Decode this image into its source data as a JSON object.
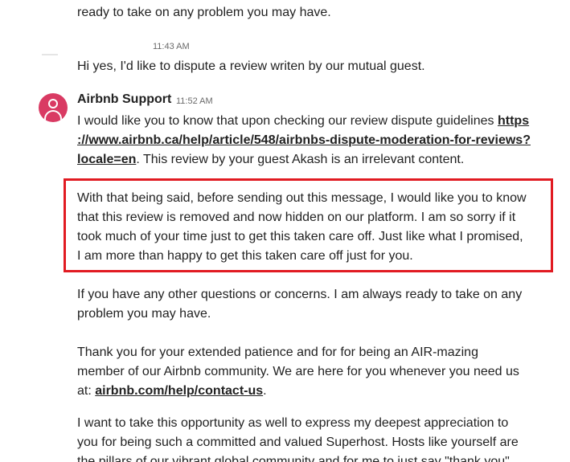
{
  "thread": {
    "top_fragment": "ready to take on any problem you may have.",
    "host_message": {
      "time": "11:43 AM",
      "text": "Hi yes, I'd like to dispute a review writen by our mutual guest."
    },
    "support_message": {
      "sender": "Airbnb Support",
      "time": "11:52 AM",
      "p1_line1_text": "I would like you to know that upon checking our review dispute guidelines ",
      "p1_link_part1": "https",
      "p1_link_part2": "://www.airbnb.ca/help/article/548/airbnbs-dispute-moderation-for-reviews?",
      "p1_link_part3": "locale=en",
      "p1_line3_rest": ". This review by your guest Akash is an irrelevant content.",
      "p2_lines": [
        "With that being said, before sending out this message, I would like you to know",
        "that this review is removed and now hidden on our platform. I am so sorry if it",
        "took much of your time just to get this taken care off. Just like what I promised,",
        "I am more than happy to get this taken care off just for you."
      ],
      "p3_lines": [
        "If you have any other questions or concerns. I am always ready to take on any",
        "problem you may have."
      ],
      "p4_lines": [
        "Thank you for your extended patience and for for being an AIR-mazing",
        "member of our Airbnb community. We are here for you whenever you need us"
      ],
      "p4_line3_prefix": "at: ",
      "p4_link": "airbnb.com/help/contact-us",
      "p4_line3_suffix": ".",
      "p5_lines": [
        "I want to take this opportunity as well to express my deepest appreciation to",
        "you for being such a committed and valued Superhost. Hosts like yourself are",
        "the pillars of our vibrant global community and for me to just say \"thank you\""
      ]
    }
  },
  "colors": {
    "avatar_bg": "#d93a63",
    "highlight_border": "#e11b22",
    "text": "#222222",
    "timestamp": "#6a6a6a"
  }
}
